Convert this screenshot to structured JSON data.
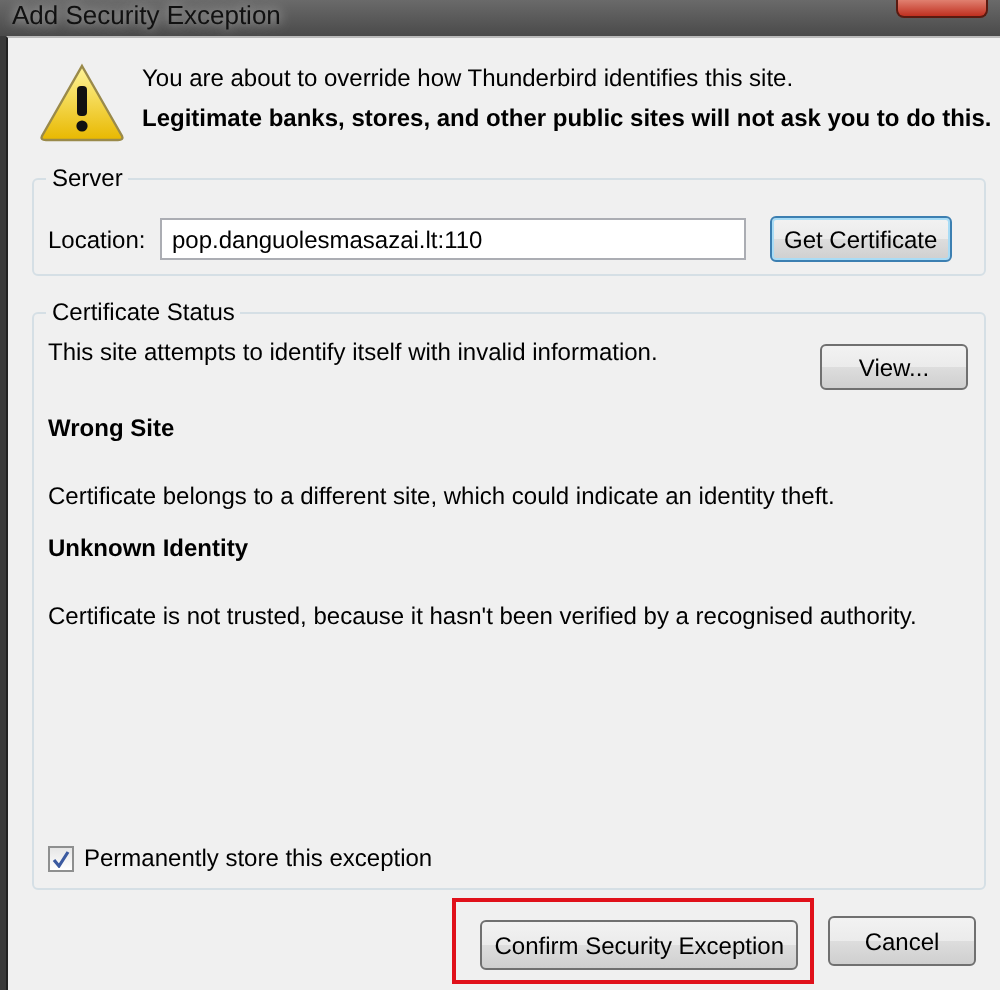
{
  "window": {
    "title": "Add Security Exception"
  },
  "warning": {
    "lines": [
      "You are about to override how Thunderbird identifies this site.",
      "Legitimate banks, stores, and other public sites will not ask you to do this."
    ]
  },
  "server": {
    "legend": "Server",
    "location_label": "Location:",
    "location_value": "pop.danguolesmasazai.lt:110",
    "button": "Get Certificate"
  },
  "certificate_status": {
    "legend": "Certificate Status",
    "summary": "This site attempts to identify itself with invalid information.",
    "view_button": "View...",
    "problems": [
      {
        "heading": "Wrong Site",
        "description": "Certificate belongs to a different site, which could indicate an identity theft."
      },
      {
        "heading": "Unknown Identity",
        "description": "Certificate is not trusted, because it hasn't been verified by a recognised authority."
      }
    ]
  },
  "permanent": {
    "label": "Permanently store this exception",
    "checked": true
  },
  "buttons": [
    {
      "label": "Confirm Security Exception",
      "highlighted": true
    },
    {
      "label": "Cancel",
      "highlighted": false
    }
  ]
}
